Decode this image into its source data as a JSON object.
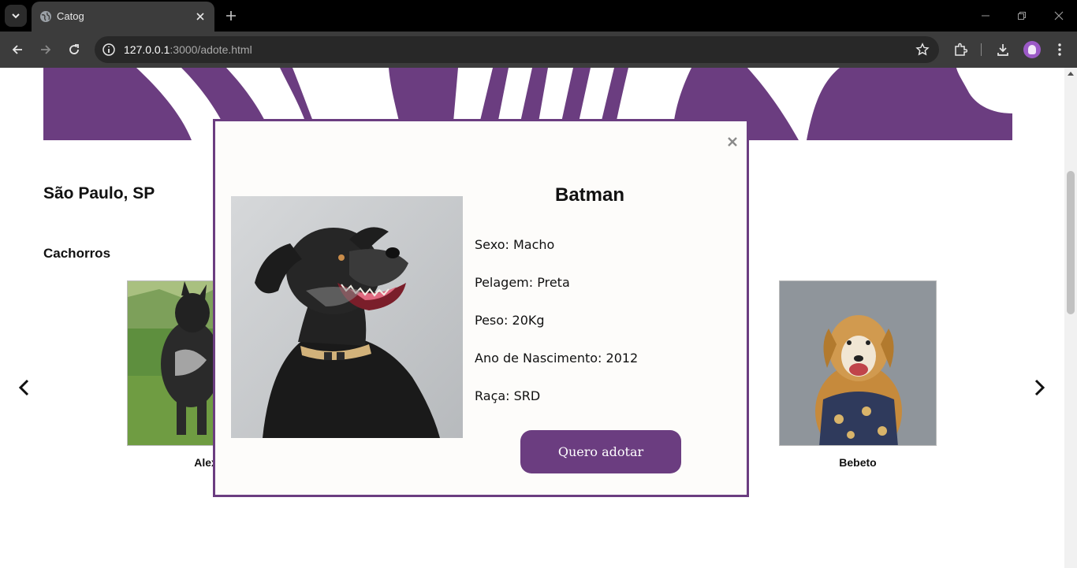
{
  "browser": {
    "tab_title": "Catog",
    "url_host": "127.0.0.1",
    "url_path": ":3000/adote.html"
  },
  "page": {
    "city": "São Paulo, SP",
    "section_title": "Cachorros",
    "cards": [
      {
        "name": "Alex",
        "visible_label": "Ale"
      },
      {
        "name": "Bebeto",
        "visible_label": "Bebeto"
      }
    ]
  },
  "modal": {
    "pet_name": "Batman",
    "fields": {
      "sexo": "Sexo: Macho",
      "pelagem": "Pelagem: Preta",
      "peso": "Peso: 20Kg",
      "nascimento": "Ano de Nascimento: 2012",
      "raca": "Raça: SRD"
    },
    "adopt_label": "Quero adotar",
    "close_symbol": "×"
  },
  "colors": {
    "brand_purple": "#6b3d80",
    "modal_bg": "#fdfcfa",
    "browser_dark": "#3c3c3c"
  },
  "icons": [
    "tab-search-icon",
    "globe-favicon-icon",
    "close-icon",
    "plus-icon",
    "minimize-icon",
    "restore-icon",
    "back-icon",
    "forward-icon",
    "reload-icon",
    "info-icon",
    "star-icon",
    "extensions-icon",
    "download-icon",
    "chevron-left-icon",
    "chevron-right-icon"
  ]
}
